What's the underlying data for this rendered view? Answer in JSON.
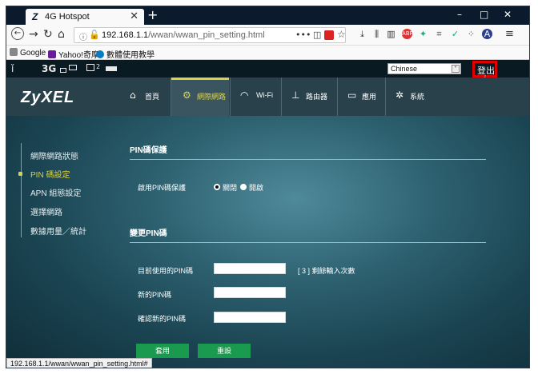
{
  "browser": {
    "tab_title": "4G Hotspot",
    "tab_favicon": "Z",
    "newtab_label": "+",
    "url_host": "192.168.1.1",
    "url_path": "/wwan/wwan_pin_setting.html",
    "url_more": "•••",
    "bookmarks": [
      "Google",
      "Yahoo!奇摩",
      "數體使用教學"
    ],
    "status_url": "192.168.1.1/wwan/wwan_pin_setting.html#",
    "window_controls": [
      "–",
      "□",
      "✕"
    ]
  },
  "statusbar": {
    "network_type": "3G",
    "sms_count": "2",
    "language": "Chinese",
    "logout_label": "登出"
  },
  "header": {
    "logo": "ZyXEL",
    "nav": [
      {
        "label": "首頁",
        "icon": "home-icon"
      },
      {
        "label": "網際網路",
        "icon": "globe-icon"
      },
      {
        "label": "Wi-Fi",
        "icon": "wifi-icon"
      },
      {
        "label": "路由器",
        "icon": "router-icon"
      },
      {
        "label": "應用",
        "icon": "monitor-icon"
      },
      {
        "label": "系統",
        "icon": "gear-icon"
      }
    ],
    "active_index": 1
  },
  "sidebar": {
    "items": [
      "網際網路狀態",
      "PIN 碼設定",
      "APN 組態設定",
      "選擇網路",
      "數據用量／統計"
    ],
    "active_index": 1
  },
  "pin_protection": {
    "title": "PIN碼保護",
    "field_label": "啟用PIN碼保護",
    "option_off": "關閉",
    "option_on": "開啟",
    "selected": "關閉"
  },
  "change_pin": {
    "title": "變更PIN碼",
    "current_label": "目前使用的PIN碼",
    "remaining_hint": "[ 3 ] 剩餘輸入次數",
    "new_label": "新的PIN碼",
    "confirm_label": "確認新的PIN碼",
    "current_value": "",
    "new_value": "",
    "confirm_value": ""
  },
  "actions": {
    "apply_label": "套用",
    "reset_label": "重設"
  },
  "colors": {
    "accent": "#d9d24a",
    "button": "#1a9a4e",
    "header": "#29414b",
    "logout_border": "#e00000"
  }
}
